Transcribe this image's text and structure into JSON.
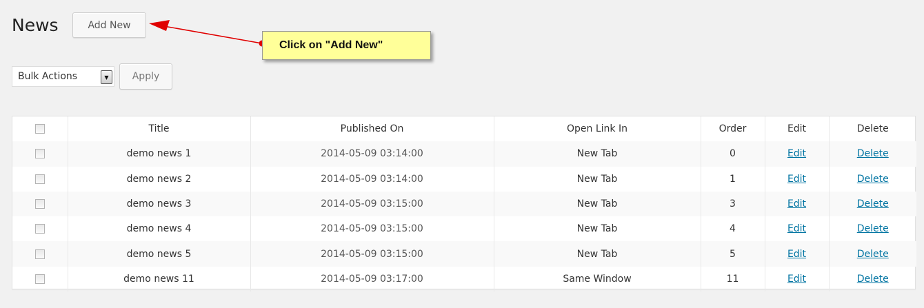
{
  "header": {
    "title": "News",
    "add_new_label": "Add New"
  },
  "bulk": {
    "selected": "Bulk Actions",
    "apply_label": "Apply"
  },
  "callout": {
    "text": "Click on \"Add New\"",
    "color": "#ffff99",
    "arrow_color": "#e00000"
  },
  "table": {
    "columns": [
      "Title",
      "Published On",
      "Open Link In",
      "Order",
      "Edit",
      "Delete"
    ],
    "rows": [
      {
        "title": "demo news 1",
        "published": "2014-05-09 03:14:00",
        "open_in": "New Tab",
        "order": "0",
        "edit": "Edit",
        "delete": "Delete"
      },
      {
        "title": "demo news 2",
        "published": "2014-05-09 03:14:00",
        "open_in": "New Tab",
        "order": "1",
        "edit": "Edit",
        "delete": "Delete"
      },
      {
        "title": "demo news 3",
        "published": "2014-05-09 03:15:00",
        "open_in": "New Tab",
        "order": "3",
        "edit": "Edit",
        "delete": "Delete"
      },
      {
        "title": "demo news 4",
        "published": "2014-05-09 03:15:00",
        "open_in": "New Tab",
        "order": "4",
        "edit": "Edit",
        "delete": "Delete"
      },
      {
        "title": "demo news 5",
        "published": "2014-05-09 03:15:00",
        "open_in": "New Tab",
        "order": "5",
        "edit": "Edit",
        "delete": "Delete"
      },
      {
        "title": "demo news 11",
        "published": "2014-05-09 03:17:00",
        "open_in": "Same Window",
        "order": "11",
        "edit": "Edit",
        "delete": "Delete"
      }
    ]
  },
  "colors": {
    "link": "#0074a2",
    "background": "#f1f1f1"
  }
}
